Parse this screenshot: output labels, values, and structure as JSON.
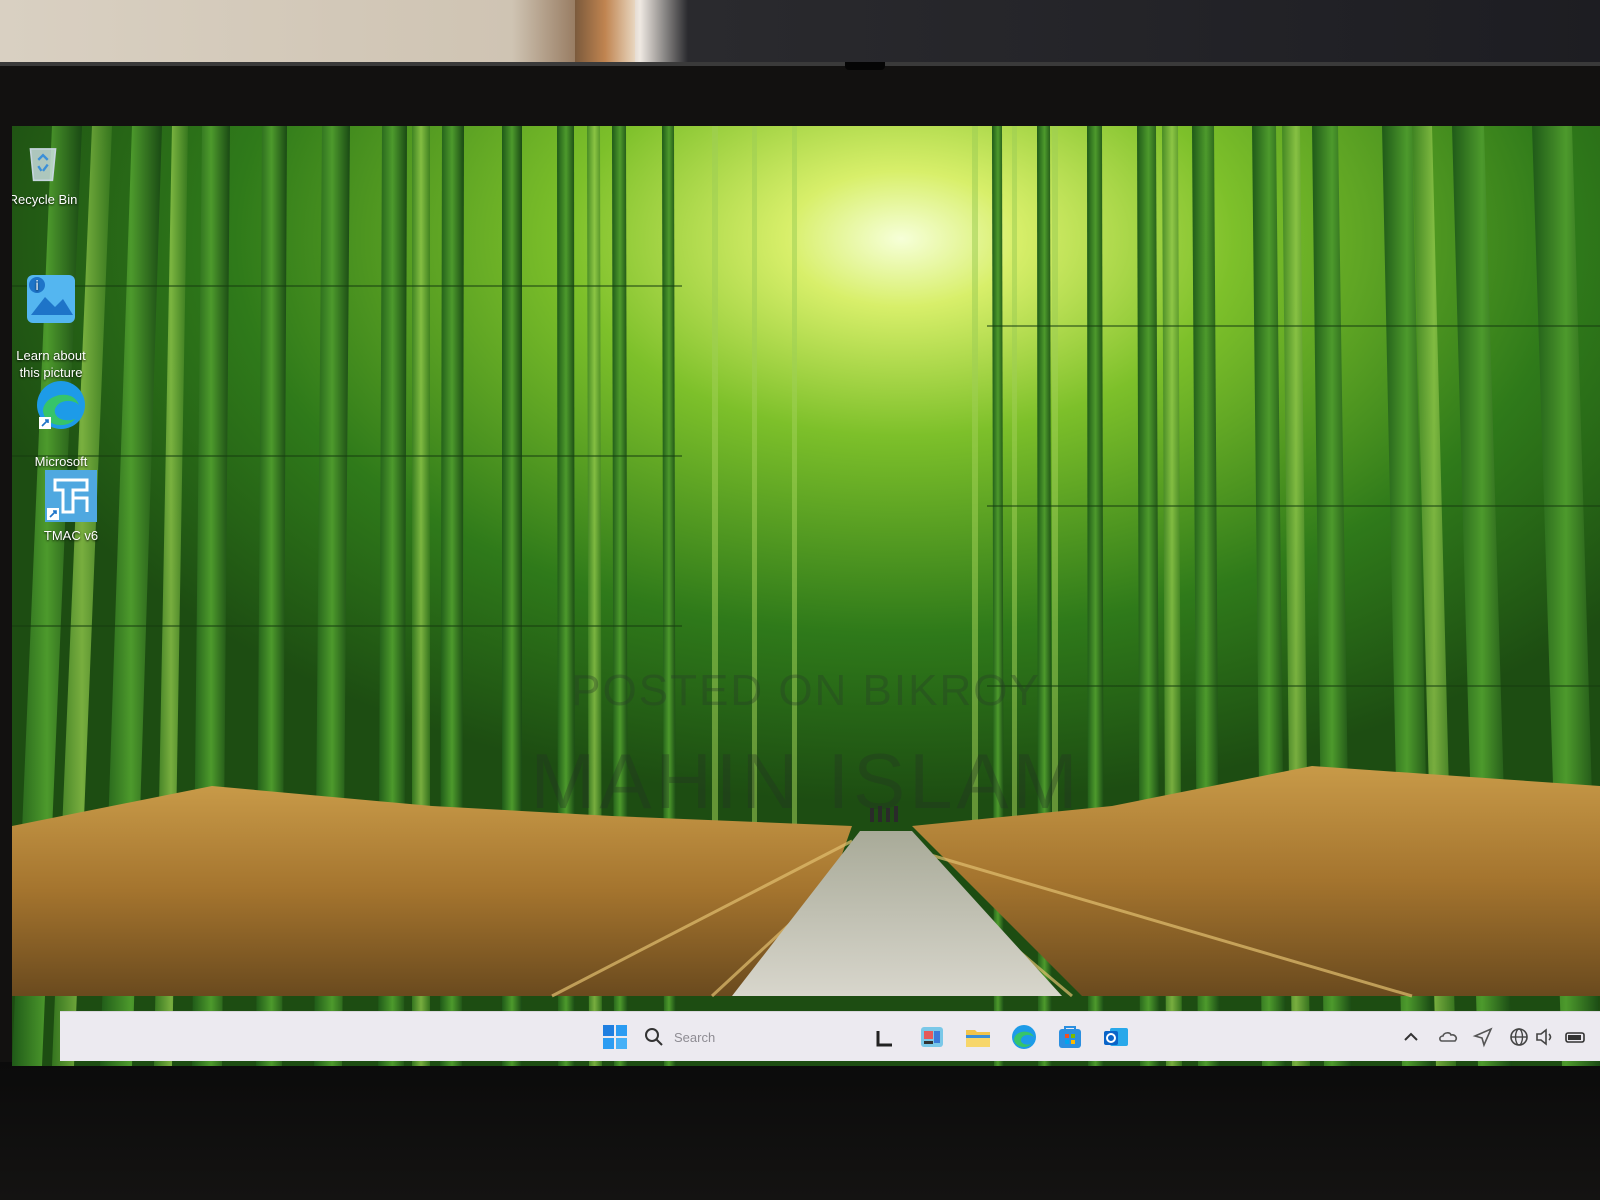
{
  "desktop": {
    "icons": [
      {
        "label": "Recycle Bin",
        "icon": "recycle-bin-icon"
      },
      {
        "label": "Learn about\nthis picture",
        "icon": "learn-about-picture-icon"
      },
      {
        "label": "Microsoft\nEdge",
        "icon": "edge-icon"
      },
      {
        "label": "TMAC v6",
        "icon": "tmac-icon"
      }
    ]
  },
  "watermark": {
    "line1": "POSTED ON BIKROY",
    "line2": "MAHIN ISLAM"
  },
  "taskbar": {
    "search_placeholder": "Search",
    "apps": [
      "start-icon",
      "task-view-icon",
      "widgets-icon",
      "file-explorer-icon",
      "edge-icon",
      "store-icon",
      "outlook-icon"
    ],
    "tray": [
      "chevron-up-icon",
      "onedrive-icon",
      "location-icon",
      "network-icon",
      "volume-icon",
      "battery-icon"
    ]
  },
  "colors": {
    "taskbar_bg": "#eceaf0",
    "start_blue": "#1f7fe0",
    "folder_yellow": "#f2c44a"
  }
}
